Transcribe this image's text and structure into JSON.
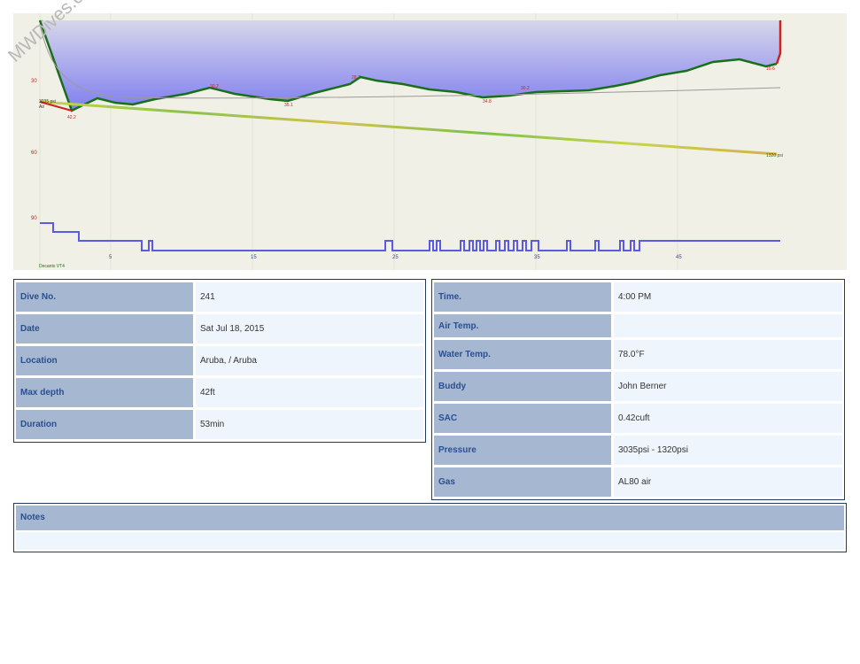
{
  "watermark": "MWDives.com",
  "profile": {
    "depth_labels": [
      "30",
      "60",
      "90"
    ],
    "time_labels": [
      "5",
      "15",
      "25",
      "35",
      "45"
    ],
    "annotations": {
      "start_pressure": "3035 psi",
      "air": "Air",
      "max_depth_mark": "42.2",
      "depth_marks": [
        "30.2",
        "35.1",
        "28.7",
        "34.8",
        "30.2",
        "10.6"
      ],
      "end_pressure": "1320 psi",
      "deco_model": "Decants VT4"
    },
    "colors": {
      "depth_fill_top": "#d6d6ea",
      "depth_fill_bottom": "#7f7ef0",
      "depth_line": "#1a6e1a",
      "pressure_line": "#c8d44a",
      "temp_line": "#5a5ae6",
      "label_red": "#cc2222"
    }
  },
  "left_table": [
    {
      "label": "Dive No.",
      "value": "241"
    },
    {
      "label": "Date",
      "value": "Sat Jul 18, 2015"
    },
    {
      "label": "Location",
      "value": "Aruba, / Aruba"
    },
    {
      "label": "Max depth",
      "value": "42ft"
    },
    {
      "label": "Duration",
      "value": "53min"
    }
  ],
  "right_table": [
    {
      "label": "Time.",
      "value": "4:00 PM"
    },
    {
      "label": "Air Temp.",
      "value": ""
    },
    {
      "label": "Water Temp.",
      "value": "78.0°F"
    },
    {
      "label": "Buddy",
      "value": "John Berner"
    },
    {
      "label": "SAC",
      "value": "0.42cuft"
    },
    {
      "label": "Pressure",
      "value": "3035psi - 1320psi"
    },
    {
      "label": "Gas",
      "value": "AL80 air"
    }
  ],
  "notes": {
    "label": "Notes",
    "value": ""
  }
}
